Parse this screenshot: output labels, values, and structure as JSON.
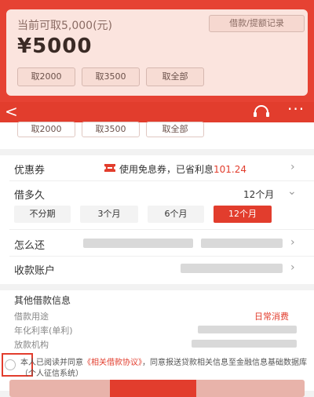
{
  "hero": {
    "available_text": "当前可取5,000(元)",
    "record_label": "借款/提额记录",
    "amount": "¥5000",
    "chips": [
      "取2000",
      "取3500",
      "取全部"
    ]
  },
  "nav": {
    "back_glyph": "<",
    "more_glyph": "···"
  },
  "sheet_chips": [
    "取2000",
    "取3500",
    "取全部"
  ],
  "coupon": {
    "label": "优惠券",
    "text": "使用免息券，已省利息",
    "saved": "101.24"
  },
  "term": {
    "label": "借多久",
    "selected": "12个月",
    "options": [
      "不分期",
      "3个月",
      "6个月",
      "12个月"
    ]
  },
  "repay": {
    "label": "怎么还"
  },
  "account": {
    "label": "收款账户"
  },
  "other": {
    "title": "其他借款信息",
    "purpose_label": "借款用途",
    "purpose_value": "日常消费",
    "rate_label": "年化利率(单利)",
    "lender_label": "放款机构"
  },
  "agreement": {
    "prefix": "本人已阅读并同意",
    "link": "《相关借款协议》",
    "suffix": "，同意报送贷款相关信息至金融信息基础数据库（个人征信系统）"
  },
  "colors": {
    "primary": "#e23d2d",
    "hero_card": "#fbe4de"
  },
  "icons": {
    "coupon": "ticket-icon",
    "service": "headset-icon"
  }
}
